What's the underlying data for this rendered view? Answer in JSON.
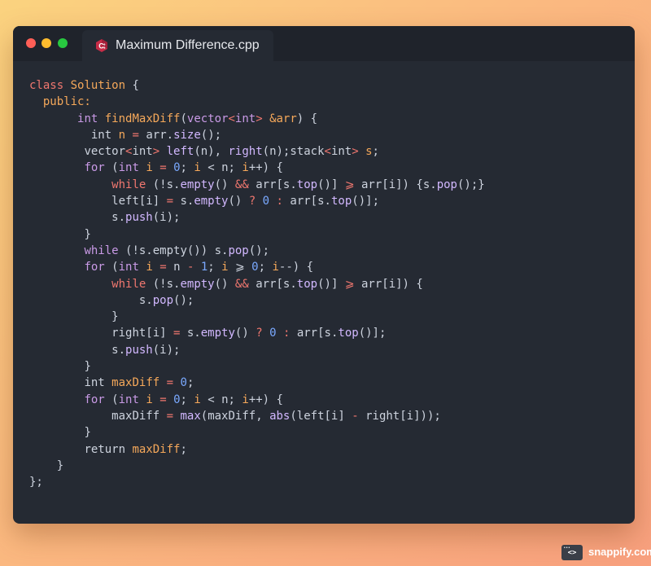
{
  "window": {
    "tab_title": "Maximum Difference.cpp",
    "tab_icon": "cpp-file-icon",
    "controls": [
      "close-dot",
      "minimize-dot",
      "maximize-dot"
    ]
  },
  "colors": {
    "keyword": "#f0776f",
    "class": "#f5a85a",
    "type": "#c99ae6",
    "function": "#f5a85a",
    "call": "#d2b8ff",
    "number": "#7aa9ff",
    "plain": "#cdd3de",
    "background": "#252a33"
  },
  "code_lines": [
    [
      [
        "class",
        "keyword"
      ],
      [
        " ",
        "plain"
      ],
      [
        "Solution",
        "class"
      ],
      [
        " {",
        "punct"
      ]
    ],
    [
      [
        "  ",
        "plain"
      ],
      [
        "public:",
        "class"
      ]
    ],
    [
      [
        "       ",
        "plain"
      ],
      [
        "int",
        "type"
      ],
      [
        " ",
        "plain"
      ],
      [
        "findMaxDiff",
        "func"
      ],
      [
        "(",
        "punct"
      ],
      [
        "vector",
        "type"
      ],
      [
        "<",
        "operator"
      ],
      [
        "int",
        "type"
      ],
      [
        "> ",
        "operator"
      ],
      [
        "&arr",
        "param"
      ],
      [
        ") {",
        "punct"
      ]
    ],
    [
      [
        "         ",
        "plain"
      ],
      [
        "int",
        "plain"
      ],
      [
        " ",
        "plain"
      ],
      [
        "n",
        "variable"
      ],
      [
        " ",
        "plain"
      ],
      [
        "=",
        "operator"
      ],
      [
        " arr.",
        "plain"
      ],
      [
        "size",
        "call"
      ],
      [
        "();",
        "punct"
      ]
    ],
    [
      [
        "        ",
        "plain"
      ],
      [
        "vector",
        "plain"
      ],
      [
        "<",
        "operator"
      ],
      [
        "int",
        "plain"
      ],
      [
        "> ",
        "operator"
      ],
      [
        "left",
        "call"
      ],
      [
        "(n), ",
        "punct"
      ],
      [
        "right",
        "call"
      ],
      [
        "(n);",
        "punct"
      ],
      [
        "stack",
        "plain"
      ],
      [
        "<",
        "operator"
      ],
      [
        "int",
        "plain"
      ],
      [
        "> ",
        "operator"
      ],
      [
        "s",
        "variable"
      ],
      [
        ";",
        "punct"
      ]
    ],
    [
      [
        "        ",
        "plain"
      ],
      [
        "for",
        "type"
      ],
      [
        " (",
        "punct"
      ],
      [
        "int",
        "type"
      ],
      [
        " ",
        "plain"
      ],
      [
        "i",
        "variable"
      ],
      [
        " ",
        "plain"
      ],
      [
        "=",
        "operator"
      ],
      [
        " ",
        "plain"
      ],
      [
        "0",
        "number"
      ],
      [
        "; ",
        "punct"
      ],
      [
        "i",
        "variable"
      ],
      [
        " < n; ",
        "plain"
      ],
      [
        "i",
        "variable"
      ],
      [
        "++) {",
        "punct"
      ]
    ],
    [
      [
        "            ",
        "plain"
      ],
      [
        "while",
        "keyword"
      ],
      [
        " (!s.",
        "plain"
      ],
      [
        "empty",
        "call"
      ],
      [
        "() ",
        "punct"
      ],
      [
        "&&",
        "operator"
      ],
      [
        " arr[s.",
        "plain"
      ],
      [
        "top",
        "call"
      ],
      [
        "()] ",
        "punct"
      ],
      [
        "⩾",
        "operator"
      ],
      [
        " arr[i]) {s.",
        "plain"
      ],
      [
        "pop",
        "call"
      ],
      [
        "();}",
        "punct"
      ]
    ],
    [
      [
        "            ",
        "plain"
      ],
      [
        "left[i] ",
        "plain"
      ],
      [
        "=",
        "operator"
      ],
      [
        " s.",
        "plain"
      ],
      [
        "empty",
        "call"
      ],
      [
        "() ",
        "punct"
      ],
      [
        "?",
        "operator"
      ],
      [
        " ",
        "plain"
      ],
      [
        "0",
        "number"
      ],
      [
        " ",
        "plain"
      ],
      [
        ":",
        "operator"
      ],
      [
        " arr[s.",
        "plain"
      ],
      [
        "top",
        "call"
      ],
      [
        "()];",
        "punct"
      ]
    ],
    [
      [
        "            ",
        "plain"
      ],
      [
        "s.",
        "plain"
      ],
      [
        "push",
        "call"
      ],
      [
        "(i);",
        "punct"
      ]
    ],
    [
      [
        "        ",
        "plain"
      ],
      [
        "}",
        "punct"
      ]
    ],
    [
      [
        "        ",
        "plain"
      ],
      [
        "while",
        "type"
      ],
      [
        " (!s.empty()) s.",
        "plain"
      ],
      [
        "pop",
        "call"
      ],
      [
        "();",
        "punct"
      ]
    ],
    [
      [
        "        ",
        "plain"
      ],
      [
        "for",
        "type"
      ],
      [
        " (",
        "punct"
      ],
      [
        "int",
        "type"
      ],
      [
        " ",
        "plain"
      ],
      [
        "i",
        "variable"
      ],
      [
        " ",
        "plain"
      ],
      [
        "=",
        "operator"
      ],
      [
        " n ",
        "plain"
      ],
      [
        "-",
        "operator"
      ],
      [
        " ",
        "plain"
      ],
      [
        "1",
        "number"
      ],
      [
        "; ",
        "punct"
      ],
      [
        "i",
        "variable"
      ],
      [
        " ",
        "plain"
      ],
      [
        "⩾",
        "plain"
      ],
      [
        " ",
        "plain"
      ],
      [
        "0",
        "number"
      ],
      [
        "; ",
        "punct"
      ],
      [
        "i",
        "variable"
      ],
      [
        "--) {",
        "punct"
      ]
    ],
    [
      [
        "            ",
        "plain"
      ],
      [
        "while",
        "keyword"
      ],
      [
        " (!s.",
        "plain"
      ],
      [
        "empty",
        "call"
      ],
      [
        "() ",
        "punct"
      ],
      [
        "&&",
        "operator"
      ],
      [
        " arr[s.",
        "plain"
      ],
      [
        "top",
        "call"
      ],
      [
        "()] ",
        "punct"
      ],
      [
        "⩾",
        "operator"
      ],
      [
        " arr[i]) {",
        "plain"
      ]
    ],
    [
      [
        "                ",
        "plain"
      ],
      [
        "s.",
        "plain"
      ],
      [
        "pop",
        "call"
      ],
      [
        "();",
        "punct"
      ]
    ],
    [
      [
        "            ",
        "plain"
      ],
      [
        "}",
        "punct"
      ]
    ],
    [
      [
        "            ",
        "plain"
      ],
      [
        "right[i] ",
        "plain"
      ],
      [
        "=",
        "operator"
      ],
      [
        " s.",
        "plain"
      ],
      [
        "empty",
        "call"
      ],
      [
        "() ",
        "punct"
      ],
      [
        "?",
        "operator"
      ],
      [
        " ",
        "plain"
      ],
      [
        "0",
        "number"
      ],
      [
        " ",
        "plain"
      ],
      [
        ":",
        "operator"
      ],
      [
        " arr[s.",
        "plain"
      ],
      [
        "top",
        "call"
      ],
      [
        "()];",
        "punct"
      ]
    ],
    [
      [
        "            ",
        "plain"
      ],
      [
        "s.",
        "plain"
      ],
      [
        "push",
        "call"
      ],
      [
        "(i);",
        "punct"
      ]
    ],
    [
      [
        "        ",
        "plain"
      ],
      [
        "}",
        "punct"
      ]
    ],
    [
      [
        "        ",
        "plain"
      ],
      [
        "int",
        "plain"
      ],
      [
        " ",
        "plain"
      ],
      [
        "maxDiff",
        "variable"
      ],
      [
        " ",
        "plain"
      ],
      [
        "=",
        "operator"
      ],
      [
        " ",
        "plain"
      ],
      [
        "0",
        "number"
      ],
      [
        ";",
        "punct"
      ]
    ],
    [
      [
        "        ",
        "plain"
      ],
      [
        "for",
        "type"
      ],
      [
        " (",
        "punct"
      ],
      [
        "int",
        "type"
      ],
      [
        " ",
        "plain"
      ],
      [
        "i",
        "variable"
      ],
      [
        " ",
        "plain"
      ],
      [
        "=",
        "operator"
      ],
      [
        " ",
        "plain"
      ],
      [
        "0",
        "number"
      ],
      [
        "; ",
        "punct"
      ],
      [
        "i",
        "variable"
      ],
      [
        " < n; ",
        "plain"
      ],
      [
        "i",
        "variable"
      ],
      [
        "++) {",
        "punct"
      ]
    ],
    [
      [
        "            ",
        "plain"
      ],
      [
        "maxDiff ",
        "plain"
      ],
      [
        "=",
        "operator"
      ],
      [
        " ",
        "plain"
      ],
      [
        "max",
        "call"
      ],
      [
        "(maxDiff, ",
        "plain"
      ],
      [
        "abs",
        "call"
      ],
      [
        "(left[i] ",
        "plain"
      ],
      [
        "-",
        "operator"
      ],
      [
        " right[i]));",
        "plain"
      ]
    ],
    [
      [
        "        ",
        "plain"
      ],
      [
        "}",
        "punct"
      ]
    ],
    [
      [
        "        ",
        "plain"
      ],
      [
        "return",
        "plain"
      ],
      [
        " ",
        "plain"
      ],
      [
        "maxDiff",
        "variable"
      ],
      [
        ";",
        "punct"
      ]
    ],
    [
      [
        "    ",
        "plain"
      ],
      [
        "}",
        "punct"
      ]
    ],
    [
      [
        "};",
        "punct"
      ]
    ]
  ],
  "watermark": {
    "logo_glyph": "<>",
    "logo_dots": "•••",
    "brand": "snappify.com"
  }
}
